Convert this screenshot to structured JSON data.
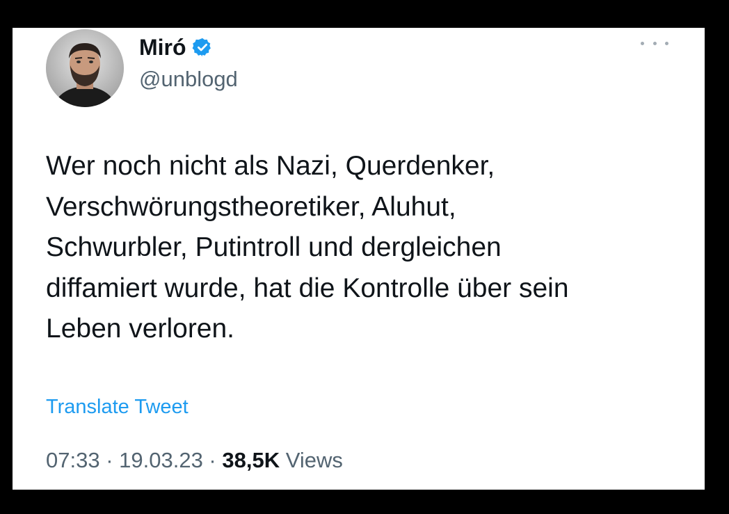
{
  "tweet": {
    "display_name": "Miró",
    "handle": "@unblogd",
    "verified_icon": "verified-badge-icon",
    "more_icon": "more-options-icon",
    "text": "Wer noch nicht als Nazi, Querdenker,\nVerschwörungstheoretiker, Aluhut,\nSchwurbler, Putintroll und dergleichen\ndiffamiert wurde, hat die Kontrolle über sein\nLeben verloren.",
    "translate_label": "Translate Tweet",
    "time": "07:33",
    "date": "19.03.23",
    "separator": " · ",
    "views_count": "38,5K",
    "views_label": " Views"
  },
  "colors": {
    "primary_text": "#0f1419",
    "secondary_text": "#536471",
    "accent": "#1d9bf0"
  }
}
